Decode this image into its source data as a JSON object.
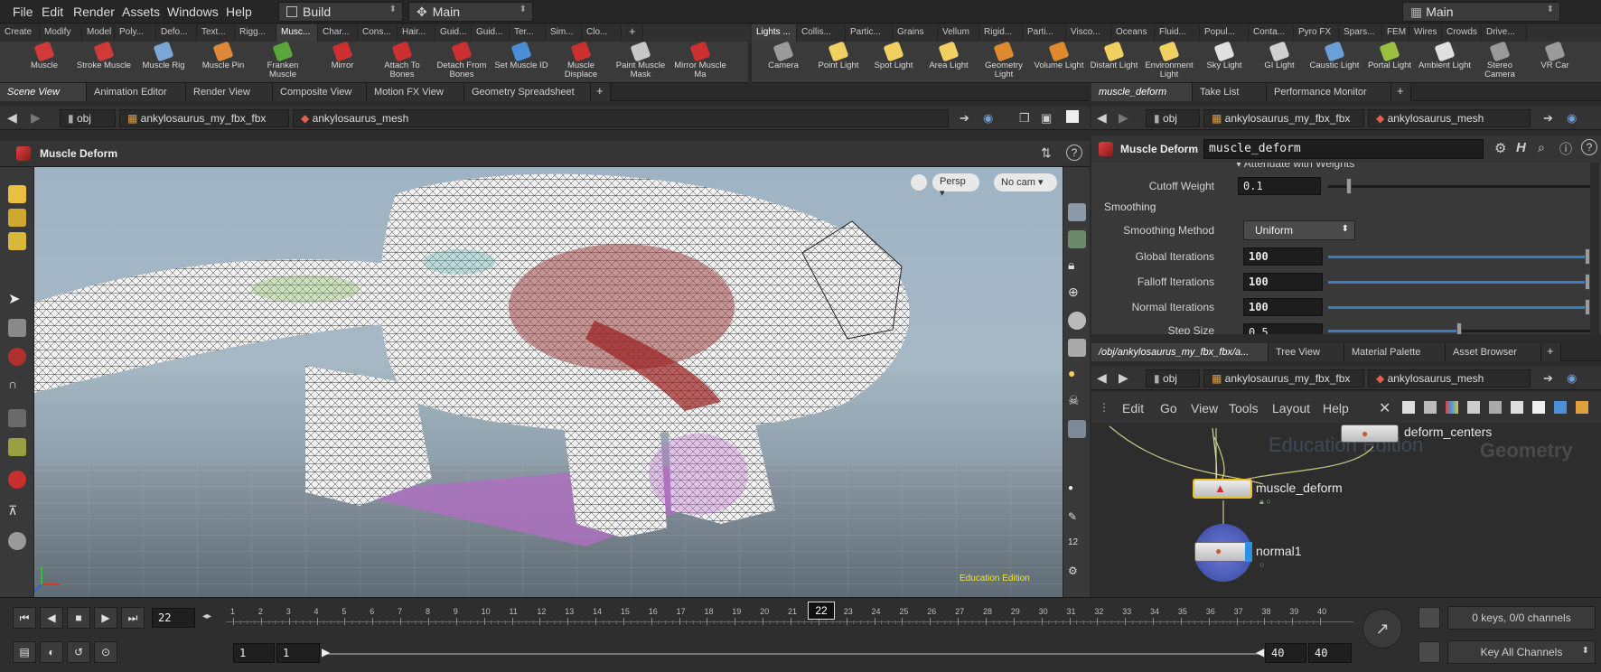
{
  "menubar": {
    "items": [
      "File",
      "Edit",
      "Render",
      "Assets",
      "Windows",
      "Help"
    ],
    "desktop_left": "Build",
    "desktop_mid": "Main",
    "desktop_right": "Main"
  },
  "shelf_left": {
    "tabs": [
      "Create",
      "Modify",
      "Model",
      "Poly...",
      "Defo...",
      "Text...",
      "Rigg...",
      "Musc...",
      "Char...",
      "Cons...",
      "Hair...",
      "Guid...",
      "Guid...",
      "Ter...",
      "Sim...",
      "Clo..."
    ],
    "tools": [
      {
        "label": "Muscle",
        "color": "#d23a3a"
      },
      {
        "label": "Stroke Muscle",
        "color": "#d23a3a"
      },
      {
        "label": "Muscle Rig",
        "color": "#7aa7d8"
      },
      {
        "label": "Muscle Pin",
        "color": "#e0883a"
      },
      {
        "label": "Franken Muscle",
        "color": "#5aa63a"
      },
      {
        "label": "Mirror",
        "color": "#cc3030"
      },
      {
        "label": "Attach To Bones",
        "color": "#cc3030"
      },
      {
        "label": "Detach From Bones",
        "color": "#cc3030"
      },
      {
        "label": "Set Muscle ID",
        "color": "#4a8ed8"
      },
      {
        "label": "Muscle Displace",
        "color": "#cc3030"
      },
      {
        "label": "Paint Muscle Mask",
        "color": "#c8c8c8"
      },
      {
        "label": "Mirror Muscle Ma",
        "color": "#cc3030"
      }
    ]
  },
  "shelf_right": {
    "tabs": [
      "Lights ...",
      "Collis...",
      "Partic...",
      "Grains",
      "Vellum",
      "Rigid...",
      "Parti...",
      "Visco...",
      "Oceans",
      "Fluid...",
      "Popul...",
      "Conta...",
      "Pyro FX",
      "Spars...",
      "FEM",
      "Wires",
      "Crowds",
      "Drive..."
    ],
    "tools": [
      {
        "label": "Camera",
        "color": "#9a9a9a"
      },
      {
        "label": "Point Light",
        "color": "#f0d060"
      },
      {
        "label": "Spot Light",
        "color": "#f0d060"
      },
      {
        "label": "Area Light",
        "color": "#f0d060"
      },
      {
        "label": "Geometry Light",
        "color": "#e08a30"
      },
      {
        "label": "Volume Light",
        "color": "#e08a30"
      },
      {
        "label": "Distant Light",
        "color": "#f0d060"
      },
      {
        "label": "Environment Light",
        "color": "#f0d060"
      },
      {
        "label": "Sky Light",
        "color": "#e0e0e0"
      },
      {
        "label": "GI Light",
        "color": "#d0d0d0"
      },
      {
        "label": "Caustic Light",
        "color": "#6aa0d8"
      },
      {
        "label": "Portal Light",
        "color": "#9ac040"
      },
      {
        "label": "Ambient Light",
        "color": "#e0e0e0"
      },
      {
        "label": "Stereo Camera",
        "color": "#9a9a9a"
      },
      {
        "label": "VR Car",
        "color": "#9a9a9a"
      }
    ]
  },
  "left_panel": {
    "tabs": [
      "Scene View",
      "Animation Editor",
      "Render View",
      "Composite View",
      "Motion FX View",
      "Geometry Spreadsheet"
    ],
    "path": [
      "obj",
      "ankylosaurus_my_fbx_fbx",
      "ankylosaurus_mesh"
    ],
    "op_title": "Muscle Deform",
    "viewport": {
      "persp": "Persp",
      "cam": "No cam",
      "watermark": "Education Edition"
    }
  },
  "param_panel": {
    "tabs": [
      "muscle_deform",
      "Take List",
      "Performance Monitor"
    ],
    "path": [
      "obj",
      "ankylosaurus_my_fbx_fbx",
      "ankylosaurus_mesh"
    ],
    "node_type": "Muscle Deform",
    "node_name": "muscle_deform",
    "attenuate_label": "Attenuate with Weights",
    "cutoff": {
      "label": "Cutoff Weight",
      "value": "0.1",
      "fraction": 0.08
    },
    "smoothing_heading": "Smoothing",
    "method": {
      "label": "Smoothing Method",
      "value": "Uniform"
    },
    "global": {
      "label": "Global Iterations",
      "value": "100",
      "fraction": 1.0
    },
    "falloff": {
      "label": "Falloff Iterations",
      "value": "100",
      "fraction": 1.0
    },
    "normal": {
      "label": "Normal Iterations",
      "value": "100",
      "fraction": 1.0
    },
    "step": {
      "label": "Step Size",
      "value": "0.5",
      "fraction": 0.5
    }
  },
  "network_panel": {
    "tabs": [
      "/obj/ankylosaurus_my_fbx_fbx/a...",
      "Tree View",
      "Material Palette",
      "Asset Browser"
    ],
    "path": [
      "obj",
      "ankylosaurus_my_fbx_fbx",
      "ankylosaurus_mesh"
    ],
    "menu": [
      "Edit",
      "Go",
      "View",
      "Tools",
      "Layout",
      "Help"
    ],
    "watermark": "Education Edition",
    "context_label": "Geometry",
    "nodes": {
      "top": "deform_centers",
      "mid": "muscle_deform",
      "bottom": "normal1"
    }
  },
  "timeline": {
    "current_frame": "22",
    "ticks": [
      "1",
      "2",
      "3",
      "4",
      "5",
      "6",
      "7",
      "8",
      "9",
      "10",
      "11",
      "12",
      "13",
      "14",
      "15",
      "16",
      "17",
      "18",
      "19",
      "20",
      "21",
      "22",
      "23",
      "24",
      "25",
      "26",
      "27",
      "28",
      "29",
      "30",
      "31",
      "32",
      "33",
      "34",
      "35",
      "36",
      "37",
      "38",
      "39",
      "40"
    ],
    "start": "1",
    "range_start": "1",
    "range_end": "40",
    "end": "40",
    "keys_info": "0 keys, 0/0 channels",
    "key_all": "Key All Channels"
  }
}
